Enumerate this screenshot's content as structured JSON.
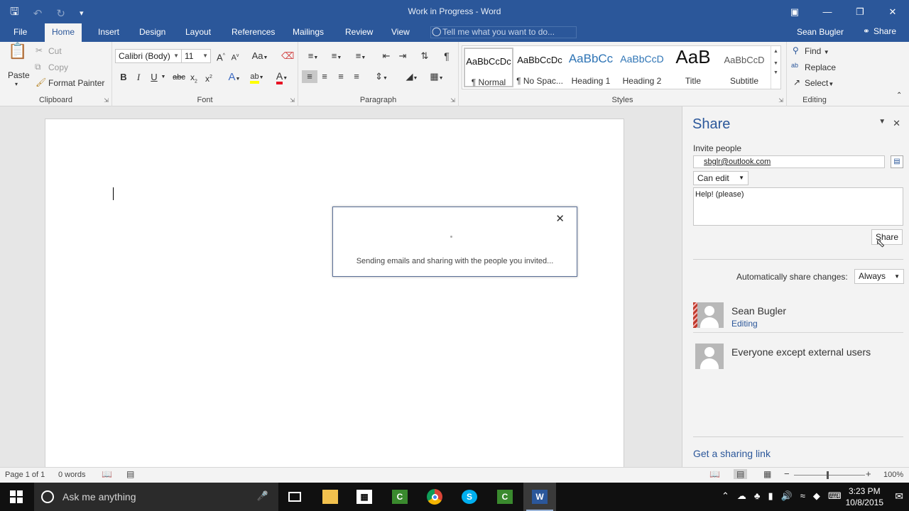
{
  "window": {
    "title": "Work in Progress - Word",
    "qat_icons": [
      "save-icon",
      "undo-icon",
      "redo-icon",
      "customize-qat-icon"
    ],
    "controls": [
      "ribbon-display-icon",
      "minimize-icon",
      "restore-icon",
      "close-icon"
    ]
  },
  "tabs": {
    "file": "File",
    "home": "Home",
    "insert": "Insert",
    "design": "Design",
    "layout": "Layout",
    "references": "References",
    "mailings": "Mailings",
    "review": "Review",
    "view": "View",
    "tell_me": "Tell me what you want to do...",
    "user": "Sean Bugler",
    "share": "Share"
  },
  "ribbon": {
    "clipboard": {
      "label": "Clipboard",
      "paste": "Paste",
      "cut": "Cut",
      "copy": "Copy",
      "format_painter": "Format Painter"
    },
    "font": {
      "label": "Font",
      "name": "Calibri (Body)",
      "size": "11"
    },
    "paragraph": {
      "label": "Paragraph"
    },
    "styles": {
      "label": "Styles",
      "items": [
        {
          "preview": "AaBbCcDc",
          "name": "¶ Normal"
        },
        {
          "preview": "AaBbCcDc",
          "name": "¶ No Spac..."
        },
        {
          "preview": "AaBbCc",
          "name": "Heading 1"
        },
        {
          "preview": "AaBbCcD",
          "name": "Heading 2"
        },
        {
          "preview": "AaB",
          "name": "Title"
        },
        {
          "preview": "AaBbCcD",
          "name": "Subtitle"
        }
      ]
    },
    "editing": {
      "label": "Editing",
      "find": "Find",
      "replace": "Replace",
      "select": "Select"
    }
  },
  "dialog": {
    "message": "Sending emails and sharing with the people you invited..."
  },
  "share_pane": {
    "title": "Share",
    "invite_label": "Invite people",
    "email": "sbglr@outlook.com",
    "permission": "Can edit",
    "note": "Help! (please)",
    "share_button": "Share",
    "auto_share_label": "Automatically share changes:",
    "auto_share_value": "Always",
    "people": [
      {
        "name": "Sean Bugler",
        "status": "Editing"
      },
      {
        "name": "Everyone except external users",
        "status": ""
      }
    ],
    "link": "Get a sharing link"
  },
  "status_bar": {
    "page": "Page 1 of 1",
    "words": "0 words",
    "zoom": "100%"
  },
  "taskbar": {
    "search_placeholder": "Ask me anything",
    "time": "3:23 PM",
    "date": "10/8/2015",
    "apps": [
      "task-view-icon",
      "file-explorer-icon",
      "store-icon",
      "camtasia-icon",
      "chrome-icon",
      "skype-icon",
      "camtasia-recorder-icon",
      "word-icon"
    ]
  }
}
